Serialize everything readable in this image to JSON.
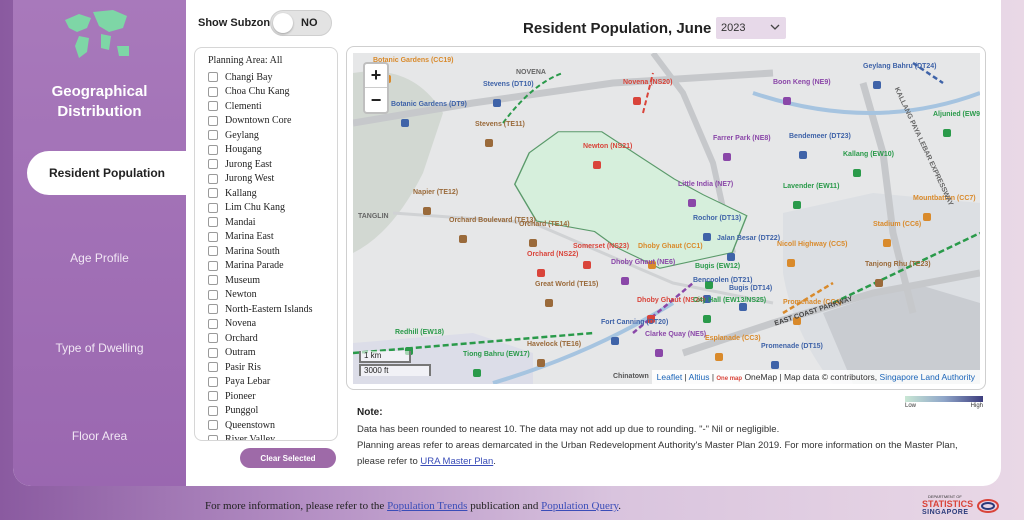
{
  "sidebar": {
    "title_line1": "Geographical",
    "title_line2": "Distribution",
    "items": [
      {
        "label": "Resident Population",
        "active": true
      },
      {
        "label": "Age Profile"
      },
      {
        "label": "Type of Dwelling"
      },
      {
        "label": "Floor Area"
      }
    ]
  },
  "controls": {
    "subzone_label": "Show Subzone:",
    "subzone_value": "NO",
    "title": "Resident Population, June",
    "year": "2023"
  },
  "planning_area": {
    "header": "Planning Area: All",
    "items": [
      "Changi Bay",
      "Choa Chu Kang",
      "Clementi",
      "Downtown Core",
      "Geylang",
      "Hougang",
      "Jurong East",
      "Jurong West",
      "Kallang",
      "Lim Chu Kang",
      "Mandai",
      "Marina East",
      "Marina South",
      "Marina Parade",
      "Museum",
      "Newton",
      "North-Eastern Islands",
      "Novena",
      "Orchard",
      "Outram",
      "Pasir Ris",
      "Paya Lebar",
      "Pioneer",
      "Punggol",
      "Queenstown",
      "River Valley"
    ],
    "clear_label": "Clear Selected"
  },
  "map": {
    "zoom_in": "+",
    "zoom_out": "−",
    "scale_km": "1 km",
    "scale_ft": "3000 ft",
    "attrib_leaflet": "Leaflet",
    "attrib_sep1": " | ",
    "attrib_altius": "Altius",
    "attrib_sep2": " | ",
    "attrib_onemap_logo": "One map",
    "attrib_onemap": " OneMap | Map data © contributors, ",
    "attrib_sla": "Singapore Land Authority",
    "road_labels": [
      "NOVENA",
      "TANGLIN",
      "KALLANG PAYA LEBAR EXPRESSWAY",
      "EAST COAST PARKWAY"
    ],
    "stations": [
      {
        "name": "Botanic Gardens (CC19)",
        "color": "#d98a2b"
      },
      {
        "name": "Stevens (DT10)",
        "color": "#3f63a8"
      },
      {
        "name": "Novena (NS20)",
        "color": "#d9443a"
      },
      {
        "name": "Boon Keng (NE9)",
        "color": "#8a47a8"
      },
      {
        "name": "Geylang Bahru (DT24)",
        "color": "#3f63a8"
      },
      {
        "name": "Botanic Gardens (DT9)",
        "color": "#3f63a8"
      },
      {
        "name": "Stevens (TE11)",
        "color": "#9a6a3a"
      },
      {
        "name": "Newton (NS21)",
        "color": "#d9443a"
      },
      {
        "name": "Farrer Park (NE8)",
        "color": "#8a47a8"
      },
      {
        "name": "Bendemeer (DT23)",
        "color": "#3f63a8"
      },
      {
        "name": "Aljunied (EW9)",
        "color": "#2a9a4a"
      },
      {
        "name": "Kallang (EW10)",
        "color": "#2a9a4a"
      },
      {
        "name": "Little India (NE7)",
        "color": "#8a47a8"
      },
      {
        "name": "Lavender (EW11)",
        "color": "#2a9a4a"
      },
      {
        "name": "Napier (TE12)",
        "color": "#9a6a3a"
      },
      {
        "name": "Orchard Boulevard (TE13)",
        "color": "#9a6a3a"
      },
      {
        "name": "Orchard (TE14)",
        "color": "#9a6a3a"
      },
      {
        "name": "Rochor (DT13)",
        "color": "#3f63a8"
      },
      {
        "name": "Mountbatten (CC7)",
        "color": "#d98a2b"
      },
      {
        "name": "Orchard (NS22)",
        "color": "#d9443a"
      },
      {
        "name": "Somerset (NS23)",
        "color": "#d9443a"
      },
      {
        "name": "Dhoby Ghaut (CC1)",
        "color": "#d98a2b"
      },
      {
        "name": "Jalan Besar (DT22)",
        "color": "#3f63a8"
      },
      {
        "name": "Nicoll Highway (CC5)",
        "color": "#d98a2b"
      },
      {
        "name": "Stadium (CC6)",
        "color": "#d98a2b"
      },
      {
        "name": "Dhoby Ghaut (NE6)",
        "color": "#8a47a8"
      },
      {
        "name": "Bugis (EW12)",
        "color": "#2a9a4a"
      },
      {
        "name": "Bencoolen (DT21)",
        "color": "#3f63a8"
      },
      {
        "name": "Tanjong Rhu (TE23)",
        "color": "#9a6a3a"
      },
      {
        "name": "Great World (TE15)",
        "color": "#9a6a3a"
      },
      {
        "name": "Bugis (DT14)",
        "color": "#3f63a8"
      },
      {
        "name": "Dhoby Ghaut (NS24)",
        "color": "#d9443a"
      },
      {
        "name": "City Hall (EW13/NS25)",
        "color": "#2a9a4a"
      },
      {
        "name": "Promenade (CC4)",
        "color": "#d98a2b"
      },
      {
        "name": "Fort Canning (DT20)",
        "color": "#3f63a8"
      },
      {
        "name": "Clarke Quay (NE5)",
        "color": "#8a47a8"
      },
      {
        "name": "Redhill (EW18)",
        "color": "#2a9a4a"
      },
      {
        "name": "Havelock (TE16)",
        "color": "#9a6a3a"
      },
      {
        "name": "Esplanade (CC3)",
        "color": "#d98a2b"
      },
      {
        "name": "Promenade (DT15)",
        "color": "#3f63a8"
      },
      {
        "name": "Tiong Bahru (EW17)",
        "color": "#2a9a4a"
      },
      {
        "name": "Chinatown",
        "color": "#555555"
      }
    ],
    "highlight_color": "#d6efdc"
  },
  "legend": {
    "low": "Low",
    "high": "High"
  },
  "notes": {
    "title": "Note:",
    "line1": "Data has been rounded to nearest 10. The data may not add up due to rounding. \"-\" Nil or negligible.",
    "line2": "Planning areas refer to areas demarcated in the Urban Redevelopment Authority's Master Plan 2019. For more information on the Master Plan,",
    "line3_prefix": "please refer to ",
    "line3_link": "URA Master Plan",
    "line3_suffix": "."
  },
  "footer": {
    "prefix": "For more information, please refer to the ",
    "link1": "Population Trends",
    "middle": " publication and ",
    "link2": "Population Query",
    "suffix": ".",
    "logo_line1": "DEPARTMENT OF",
    "logo_line2": "STATISTICS",
    "logo_line3": "SINGAPORE"
  },
  "colors": {
    "accent": "#9e6aa8",
    "sidebar": "#a879bb",
    "link": "#3a4db8"
  }
}
